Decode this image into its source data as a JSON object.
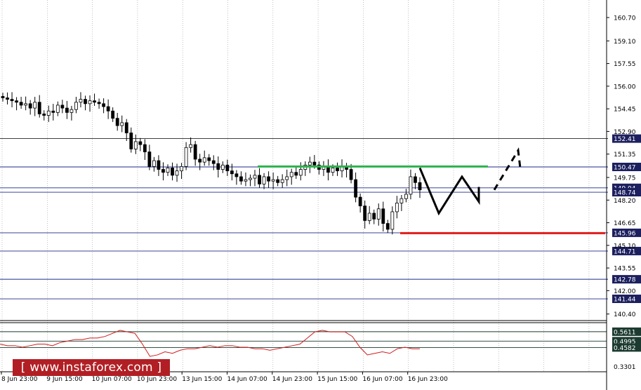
{
  "watermark": "[  www.instaforex.com  ]",
  "chart_data": {
    "type": "candlestick",
    "price_axis": {
      "ticks": [
        "160.70",
        "159.10",
        "157.55",
        "156.00",
        "154.45",
        "152.90",
        "151.35",
        "149.75",
        "148.20",
        "146.65",
        "145.10",
        "143.55",
        "142.00",
        "140.40"
      ],
      "range": [
        140.0,
        161.9
      ]
    },
    "levels": [
      {
        "label": "152.41",
        "value": 152.41
      },
      {
        "label": "150.47",
        "value": 150.47
      },
      {
        "label": "149.04",
        "value": 149.04
      },
      {
        "label": "148.74",
        "value": 148.74
      },
      {
        "label": "145.96",
        "value": 145.96
      },
      {
        "label": "144.71",
        "value": 144.71
      },
      {
        "label": "142.78",
        "value": 142.78
      },
      {
        "label": "141.44",
        "value": 141.44
      }
    ],
    "resistance_line": {
      "value": 150.5,
      "color": "#2bb24c"
    },
    "support_line": {
      "value": 145.94,
      "color": "#e01b1b"
    },
    "forecast_path": [
      150.4,
      147.3,
      149.8,
      148.1,
      149.1
    ],
    "forecast_dashed": [
      148.9,
      151.6,
      150.4
    ],
    "candles_close": [
      155.2,
      155.1,
      155.0,
      154.9,
      154.7,
      154.8,
      154.5,
      154.9,
      154.1,
      154.0,
      154.3,
      154.2,
      154.7,
      154.5,
      154.2,
      154.4,
      154.9,
      155.1,
      154.8,
      155.0,
      154.9,
      154.8,
      154.6,
      154.3,
      153.8,
      153.3,
      153.5,
      152.8,
      151.7,
      152.2,
      152.0,
      151.5,
      150.5,
      150.9,
      150.3,
      150.1,
      150.4,
      149.9,
      150.2,
      150.5,
      151.8,
      152.0,
      151.0,
      150.8,
      151.1,
      150.9,
      150.7,
      150.3,
      150.6,
      150.2,
      150.0,
      149.8,
      149.5,
      149.6,
      149.7,
      149.9,
      149.3,
      149.8,
      149.5,
      149.6,
      149.4,
      149.6,
      149.8,
      150.1,
      149.9,
      150.3,
      150.6,
      150.8,
      150.6,
      150.3,
      150.5,
      150.1,
      150.4,
      150.2,
      150.5,
      150.3,
      149.6,
      148.4,
      147.8,
      146.8,
      147.3,
      146.9,
      147.6,
      146.6,
      146.2,
      147.4,
      148.0,
      148.3,
      148.6,
      149.8,
      149.4,
      148.9
    ],
    "oscillator": {
      "levels": [
        {
          "label": "0.5611",
          "value": 0.5611
        },
        {
          "label": "0.4995",
          "value": 0.4995
        },
        {
          "label": "0.4582",
          "value": 0.4582
        }
      ],
      "min_label": "0.3301",
      "values": [
        0.48,
        0.47,
        0.47,
        0.46,
        0.47,
        0.48,
        0.48,
        0.47,
        0.49,
        0.5,
        0.51,
        0.51,
        0.52,
        0.52,
        0.53,
        0.55,
        0.57,
        0.56,
        0.55,
        0.48,
        0.4,
        0.41,
        0.43,
        0.42,
        0.44,
        0.45,
        0.45,
        0.46,
        0.47,
        0.46,
        0.47,
        0.47,
        0.46,
        0.46,
        0.45,
        0.45,
        0.44,
        0.45,
        0.46,
        0.47,
        0.48,
        0.52,
        0.56,
        0.57,
        0.56,
        0.56,
        0.56,
        0.53,
        0.46,
        0.41,
        0.42,
        0.43,
        0.42,
        0.45,
        0.46,
        0.45,
        0.45
      ]
    },
    "time_labels": [
      "8 Jun 23:00",
      "9 Jun 15:00",
      "10 Jun 07:00",
      "10 Jun 23:00",
      "13 Jun 15:00",
      "14 Jun 07:00",
      "14 Jun 23:00",
      "15 Jun 15:00",
      "16 Jun 07:00",
      "16 Jun 23:00"
    ]
  }
}
